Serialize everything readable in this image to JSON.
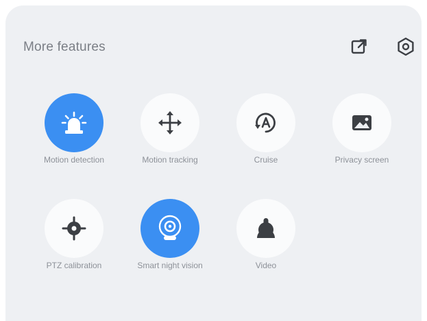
{
  "header": {
    "title": "More features"
  },
  "colors": {
    "panel_background": "#eef0f3",
    "active_accent": "#3b8ff2",
    "icon_dark": "#3c3f44",
    "label_gray": "#8d9198"
  },
  "features": [
    {
      "label": "Motion detection",
      "icon": "siren-icon",
      "active": true
    },
    {
      "label": "Motion tracking",
      "icon": "move-arrows-icon",
      "active": false
    },
    {
      "label": "Cruise",
      "icon": "auto-rotate-icon",
      "active": false
    },
    {
      "label": "Privacy screen",
      "icon": "privacy-image-icon",
      "active": false
    },
    {
      "label": "PTZ calibration",
      "icon": "target-crosshair-icon",
      "active": false
    },
    {
      "label": "Smart night vision",
      "icon": "night-vision-icon",
      "active": true
    },
    {
      "label": "Video",
      "icon": "joystick-icon",
      "active": false
    }
  ]
}
